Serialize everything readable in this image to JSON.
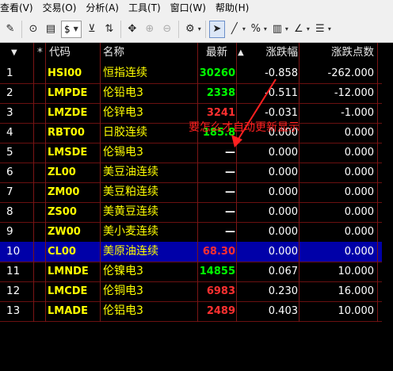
{
  "menu": [
    "查看(V)",
    "交易(O)",
    "分析(A)",
    "工具(T)",
    "窗口(W)",
    "帮助(H)"
  ],
  "toolbar": {
    "currency": "$",
    "icons": [
      "edit-icon",
      "play-icon",
      "note-icon",
      "currency-combo",
      "filter-icon",
      "sort-icon",
      "move-icon",
      "zoom-in-icon",
      "zoom-out-icon",
      "settings-icon",
      "cursor-icon",
      "line-icon",
      "percent-icon",
      "bars-icon",
      "draw-icon",
      "list-icon"
    ]
  },
  "columns": {
    "sort_arrow": "▼",
    "star": "*",
    "code": "代码",
    "name": "名称",
    "last": "最新",
    "last_sort": "▲",
    "change_rate": "涨跌幅",
    "change_points": "涨跌点数"
  },
  "rows": [
    {
      "num": "1",
      "code": "HSI00",
      "name": "恒指连续",
      "last": "30260",
      "last_color": "green",
      "change_rate": "-0.858",
      "change_points": "-262.000"
    },
    {
      "num": "2",
      "code": "LMPDE",
      "name": "伦铅电3",
      "last": "2338",
      "last_color": "green",
      "change_rate": "-0.511",
      "change_points": "-12.000"
    },
    {
      "num": "3",
      "code": "LMZDE",
      "name": "伦锌电3",
      "last": "3241",
      "last_color": "red",
      "change_rate": "-0.031",
      "change_points": "-1.000"
    },
    {
      "num": "4",
      "code": "RBT00",
      "name": "日胶连续",
      "last": "185.8",
      "last_color": "green",
      "change_rate": "0.000",
      "change_points": "0.000"
    },
    {
      "num": "5",
      "code": "LMSDE",
      "name": "伦锡电3",
      "last": "—",
      "last_color": "white",
      "change_rate": "0.000",
      "change_points": "0.000"
    },
    {
      "num": "6",
      "code": "ZL00",
      "name": "美豆油连续",
      "last": "—",
      "last_color": "white",
      "change_rate": "0.000",
      "change_points": "0.000"
    },
    {
      "num": "7",
      "code": "ZM00",
      "name": "美豆粕连续",
      "last": "—",
      "last_color": "white",
      "change_rate": "0.000",
      "change_points": "0.000"
    },
    {
      "num": "8",
      "code": "ZS00",
      "name": "美黄豆连续",
      "last": "—",
      "last_color": "white",
      "change_rate": "0.000",
      "change_points": "0.000"
    },
    {
      "num": "9",
      "code": "ZW00",
      "name": "美小麦连续",
      "last": "—",
      "last_color": "white",
      "change_rate": "0.000",
      "change_points": "0.000"
    },
    {
      "num": "10",
      "code": "CL00",
      "name": "美原油连续",
      "last": "68.30",
      "last_color": "red",
      "change_rate": "0.000",
      "change_points": "0.000",
      "selected": true
    },
    {
      "num": "11",
      "code": "LMNDE",
      "name": "伦镍电3",
      "last": "14855",
      "last_color": "green",
      "change_rate": "0.067",
      "change_points": "10.000"
    },
    {
      "num": "12",
      "code": "LMCDE",
      "name": "伦铜电3",
      "last": "6983",
      "last_color": "red",
      "change_rate": "0.230",
      "change_points": "16.000"
    },
    {
      "num": "13",
      "code": "LMADE",
      "name": "伦铝电3",
      "last": "2489",
      "last_color": "red",
      "change_rate": "0.403",
      "change_points": "10.000"
    }
  ],
  "annotation": "要怎么才自动更新显示",
  "colors": {
    "green": "#00ff00",
    "red": "#ff3030",
    "yellow": "#ffff00",
    "selection": "#0000a8",
    "grid_line": "#7a1515"
  }
}
